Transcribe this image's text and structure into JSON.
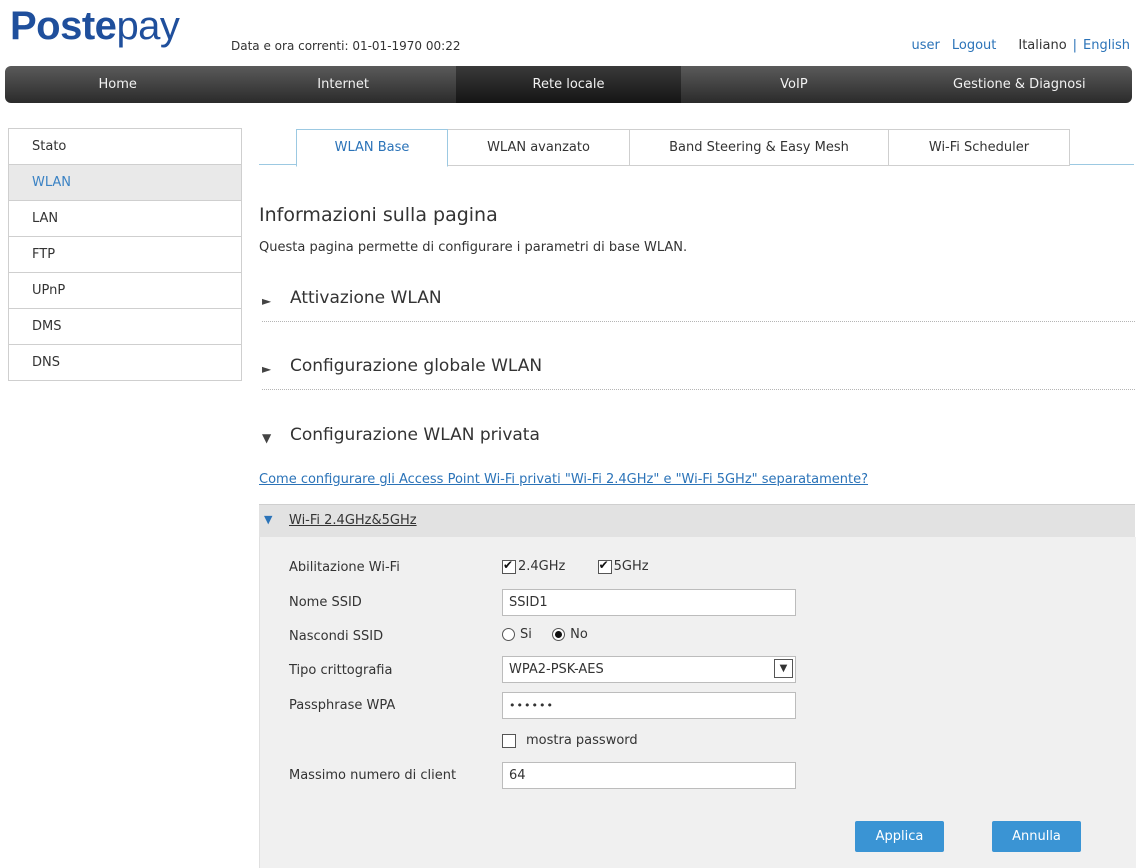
{
  "header": {
    "logo_bold": "Poste",
    "logo_thin": "pay",
    "datetime": "Data e ora correnti: 01-01-1970 00:22",
    "user": "user",
    "logout": "Logout",
    "lang_it": "Italiano",
    "lang_sep": "|",
    "lang_en": "English"
  },
  "nav": {
    "items": [
      "Home",
      "Internet",
      "Rete locale",
      "VoIP",
      "Gestione & Diagnosi"
    ],
    "active": "Rete locale"
  },
  "sidebar": {
    "items": [
      "Stato",
      "WLAN",
      "LAN",
      "FTP",
      "UPnP",
      "DMS",
      "DNS"
    ],
    "active": "WLAN"
  },
  "tabs": {
    "items": [
      "WLAN Base",
      "WLAN avanzato",
      "Band Steering & Easy Mesh",
      "Wi-Fi Scheduler"
    ],
    "active": "WLAN Base"
  },
  "page": {
    "title": "Informazioni sulla pagina",
    "description": "Questa pagina permette di configurare i parametri di base WLAN."
  },
  "sections": {
    "activation": "Attivazione WLAN",
    "global": "Configurazione globale WLAN",
    "private": "Configurazione WLAN privata",
    "collapsed_glyph": "►",
    "expanded_glyph": "▼"
  },
  "help_link": "Come configurare gli Access Point Wi-Fi privati \"Wi-Fi 2.4GHz\" e \"Wi-Fi 5GHz\" separatamente?",
  "wifi": {
    "panel_title": "Wi-Fi 2.4GHz&5GHz",
    "enable_label": "Abilitazione Wi-Fi",
    "band_24": "2.4GHz",
    "band_5": "5GHz",
    "band_24_checked": true,
    "band_5_checked": true,
    "ssid_label": "Nome SSID",
    "ssid_value": "SSID1",
    "hide_label": "Nascondi SSID",
    "hide_yes": "Si",
    "hide_no": "No",
    "hide_selected": "No",
    "crypto_label": "Tipo crittografia",
    "crypto_value": "WPA2-PSK-AES",
    "pass_label": "Passphrase WPA",
    "pass_masked": "••••••",
    "show_pass_label": "mostra password",
    "show_pass_checked": false,
    "maxclient_label": "Massimo numero di client",
    "maxclient_value": "64"
  },
  "buttons": {
    "apply": "Applica",
    "cancel": "Annulla"
  },
  "colors": {
    "brand": "#1f4f9c",
    "link": "#2b73b8",
    "button": "#3a94d4",
    "panel_bg": "#f0f0f0"
  }
}
